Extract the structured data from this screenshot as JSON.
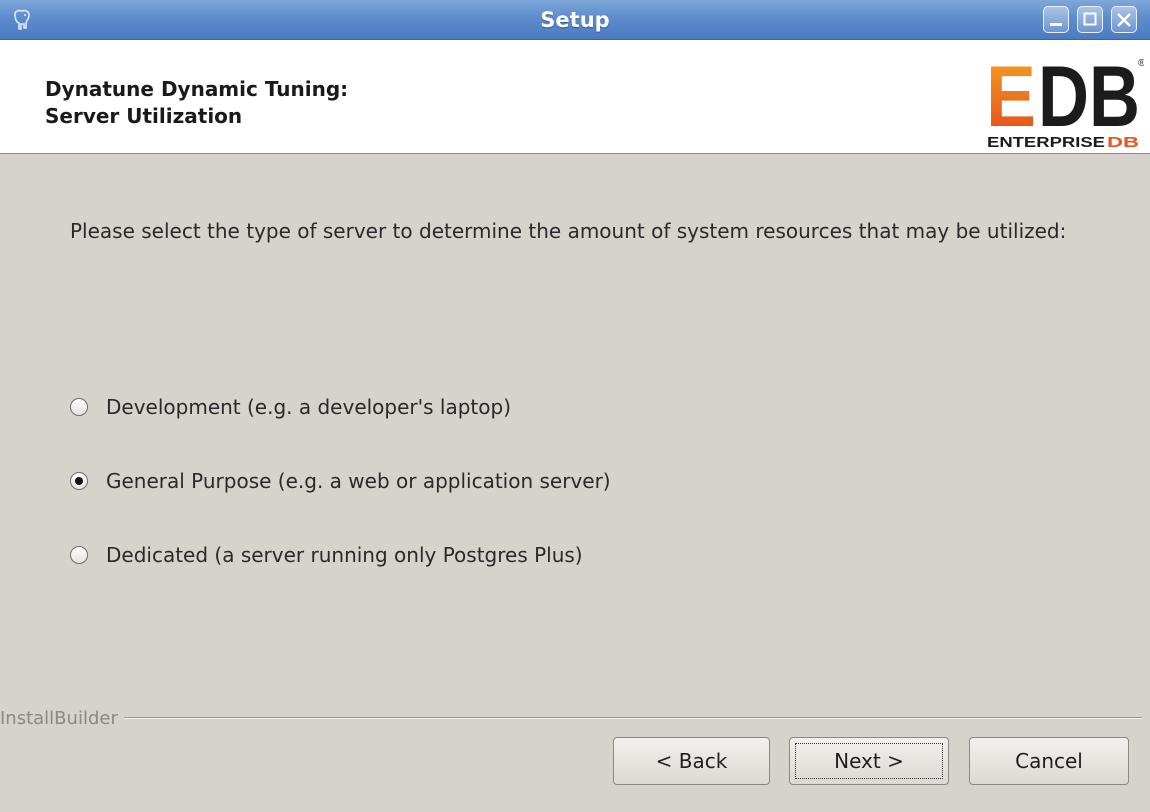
{
  "window": {
    "title": "Setup",
    "icon": "postgres-elephant-icon",
    "controls": [
      "minimize-icon",
      "maximize-icon",
      "close-icon"
    ]
  },
  "header": {
    "title_line1": "Dynatune Dynamic Tuning:",
    "title_line2": "Server Utilization",
    "logo": {
      "mark": "EDB",
      "wordmark_left": "ENTERPRISE",
      "wordmark_right": "DB",
      "registered": "®",
      "accent_color": "#e8561f"
    }
  },
  "main": {
    "instructions": "Please select the type of server to determine the amount of system resources that may be utilized:",
    "options": [
      {
        "label": "Development (e.g. a developer's laptop)",
        "selected": false
      },
      {
        "label": "General Purpose (e.g. a web or application server)",
        "selected": true
      },
      {
        "label": "Dedicated (a server running only Postgres Plus)",
        "selected": false
      }
    ]
  },
  "footer": {
    "branding": "InstallBuilder",
    "back_label": "< Back",
    "next_label": "Next >",
    "cancel_label": "Cancel"
  }
}
